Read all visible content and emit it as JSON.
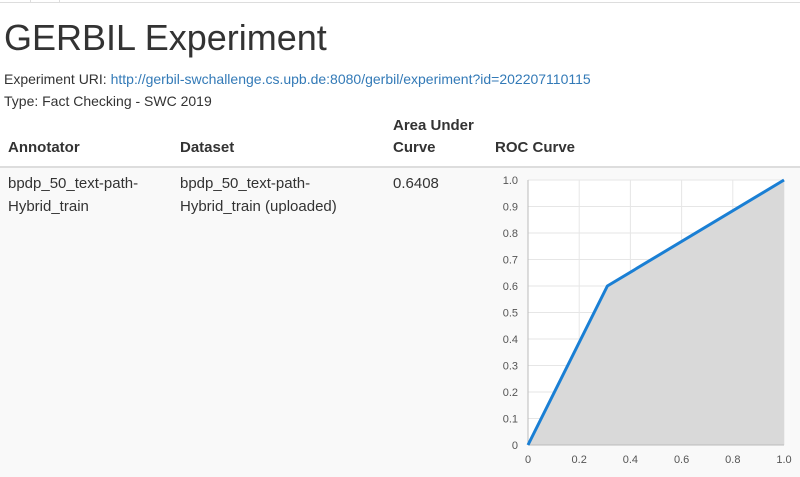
{
  "page": {
    "title": "GERBIL Experiment",
    "uri_label": "Experiment URI:",
    "uri": "http://gerbil-swchallenge.cs.upb.de:8080/gerbil/experiment?id=202207110115",
    "type_line": "Type: Fact Checking - SWC 2019"
  },
  "table": {
    "headers": {
      "annotator": "Annotator",
      "dataset": "Dataset",
      "auc": "Area Under Curve",
      "roc": "ROC Curve"
    },
    "rows": [
      {
        "annotator": "bpdp_50_text-path-Hybrid_train",
        "dataset": "bpdp_50_text-path-Hybrid_train (uploaded)",
        "auc": "0.6408"
      }
    ]
  },
  "chart_data": {
    "type": "area",
    "x": [
      0,
      0.31,
      1.0
    ],
    "y": [
      0,
      0.6,
      1.0
    ],
    "xlim": [
      0,
      1
    ],
    "ylim": [
      0,
      1
    ],
    "xticks": [
      "0",
      "0.2",
      "0.4",
      "0.6",
      "0.8",
      "1.0"
    ],
    "yticks": [
      "0",
      "0.1",
      "0.2",
      "0.3",
      "0.4",
      "0.5",
      "0.6",
      "0.7",
      "0.8",
      "0.9",
      "1.0"
    ],
    "grid": true,
    "line_color": "#1a7fd4",
    "fill_color": "#d9d9d9",
    "grid_color": "#e6e6e6"
  }
}
